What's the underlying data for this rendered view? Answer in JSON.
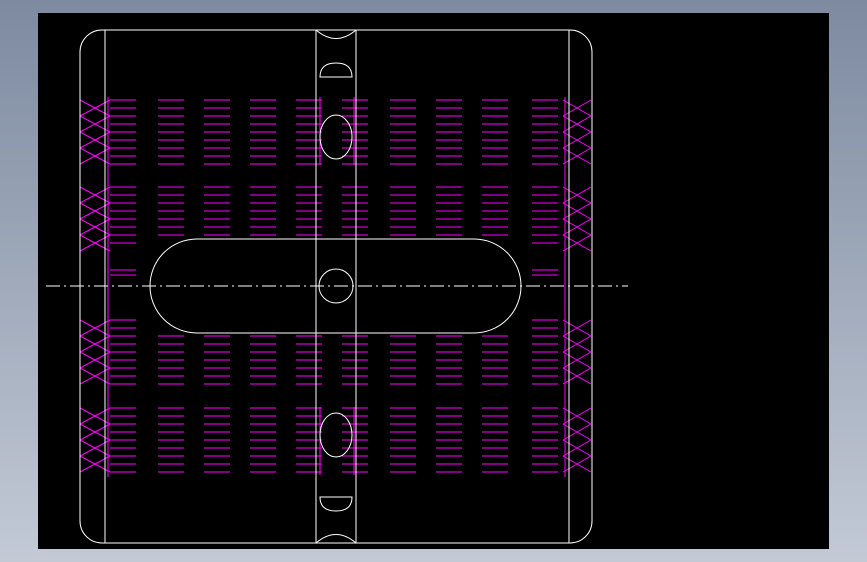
{
  "app": {
    "background_gradient": [
      "#7d8aa0",
      "#c3cad6"
    ],
    "canvas_color": "#000000"
  },
  "drawing": {
    "outline_color": "#ffffff",
    "hidden_line_color": "#ff00ff",
    "centerline_color": "#ffffff",
    "body": "rounded-rectangle",
    "center_groove": "vertical",
    "slot": "horizontal-obround",
    "hole": "circle",
    "hatching": "dashed-hidden-lines"
  }
}
